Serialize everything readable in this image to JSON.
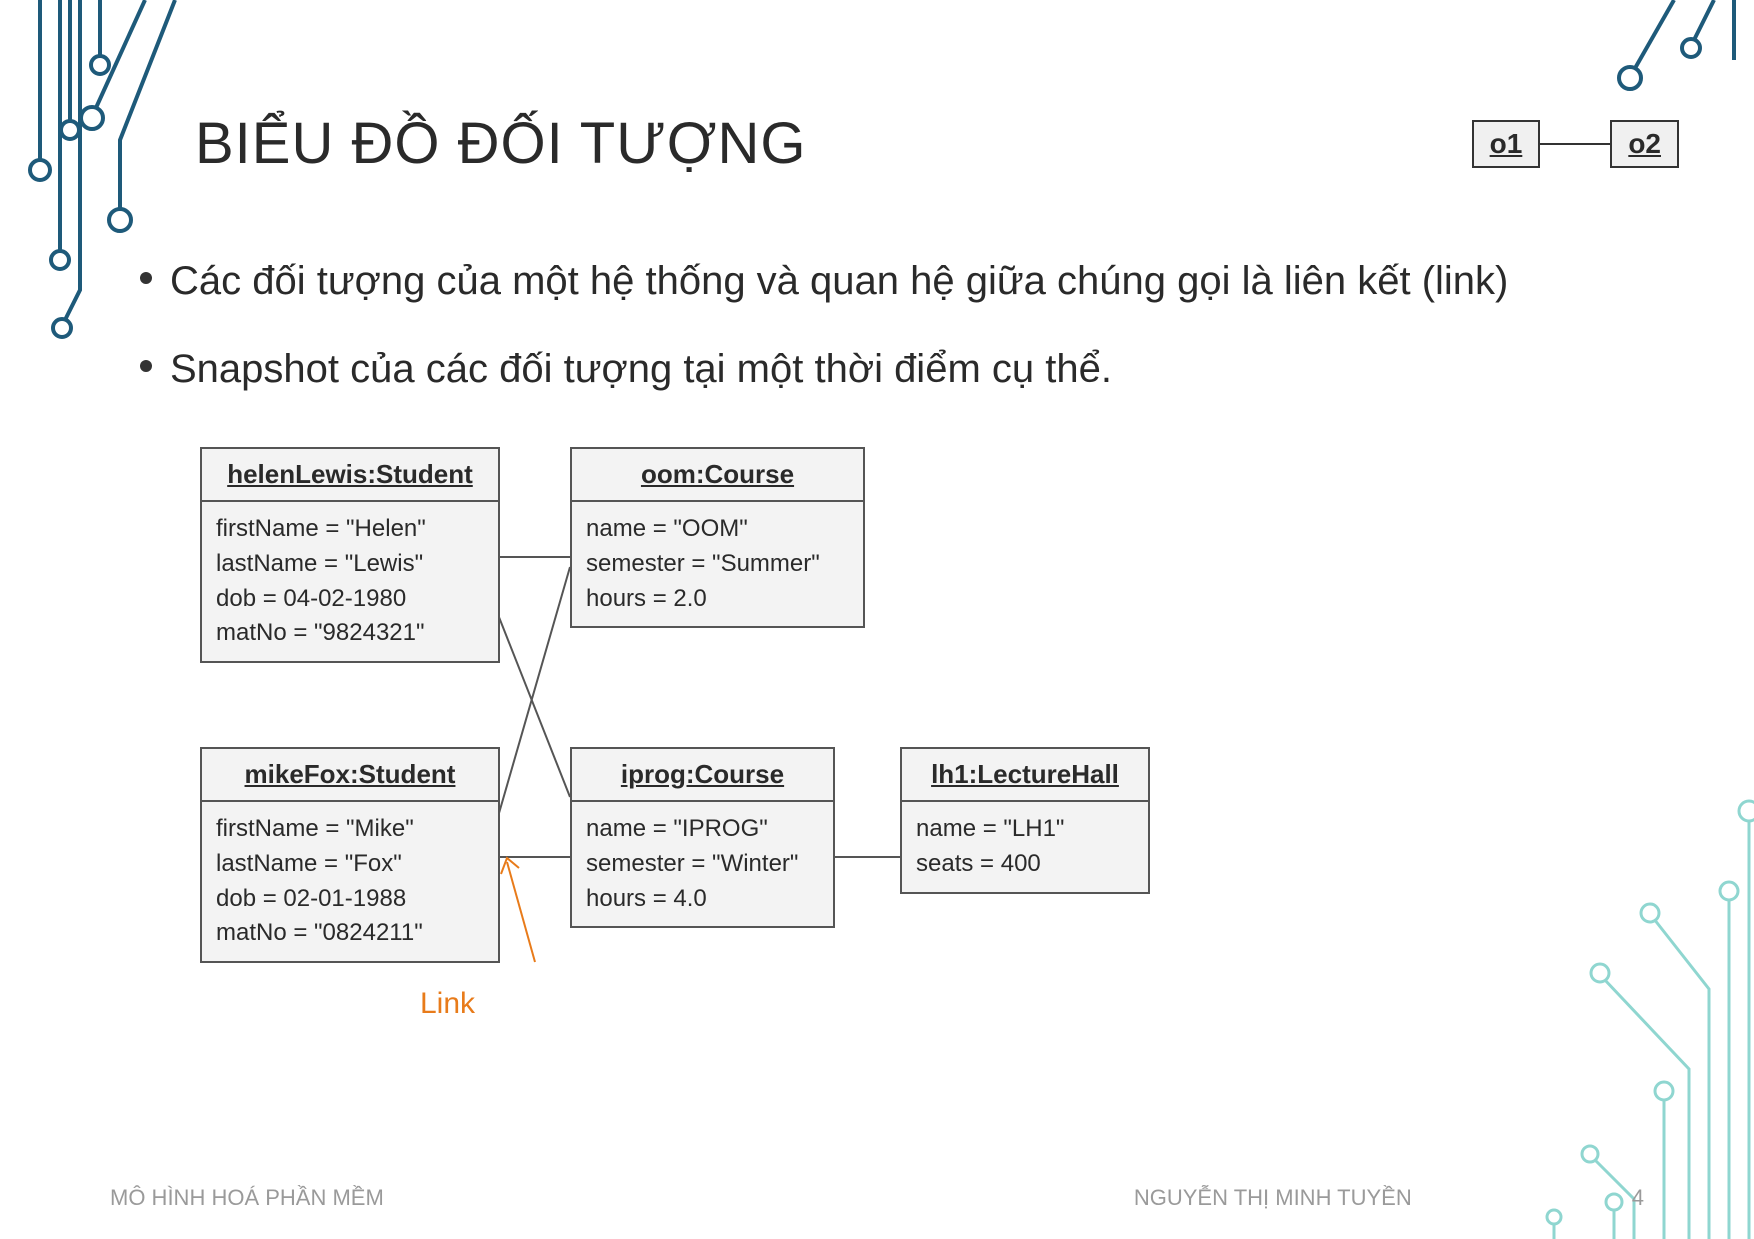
{
  "title": "BIỂU ĐỒ ĐỐI TƯỢNG",
  "notation": {
    "o1": "o1",
    "o2": "o2"
  },
  "bullets": [
    "Các đối tượng của một hệ thống và quan hệ giữa chúng gọi là liên kết (link)",
    "Snapshot của các đối tượng tại một thời điểm cụ thể."
  ],
  "objects": {
    "helen": {
      "header": "helenLewis:Student",
      "attrs": [
        "firstName = \"Helen\"",
        "lastName = \"Lewis\"",
        "dob = 04-02-1980",
        "matNo = \"9824321\""
      ]
    },
    "oom": {
      "header": "oom:Course",
      "attrs": [
        "name = \"OOM\"",
        "semester = \"Summer\"",
        "hours = 2.0"
      ]
    },
    "mike": {
      "header": "mikeFox:Student",
      "attrs": [
        "firstName = \"Mike\"",
        "lastName = \"Fox\"",
        "dob = 02-01-1988",
        "matNo = \"0824211\""
      ]
    },
    "iprog": {
      "header": "iprog:Course",
      "attrs": [
        "name = \"IPROG\"",
        "semester = \"Winter\"",
        "hours = 4.0"
      ]
    },
    "lh1": {
      "header": "lh1:LectureHall",
      "attrs": [
        "name = \"LH1\"",
        "seats = 400"
      ]
    }
  },
  "link_label": "Link",
  "footer": {
    "left": "MÔ HÌNH HOÁ PHẦN MỀM",
    "right": "NGUYỄN THỊ MINH TUYỀN",
    "page": "4"
  }
}
